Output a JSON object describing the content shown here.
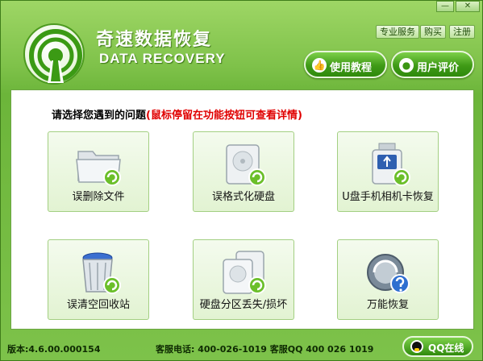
{
  "window": {
    "minimize_symbol": "—",
    "close_symbol": "✕"
  },
  "app": {
    "title": "奇速数据恢复",
    "subtitle": "DATA RECOVERY",
    "logo_icon": "signal-tower-icon"
  },
  "top_links": {
    "pro_service": "专业服务",
    "buy": "购买",
    "register": "注册"
  },
  "header_buttons": {
    "tutorial": {
      "label": "使用教程",
      "icon": "thumbs-up-icon"
    },
    "review": {
      "label": "用户评价",
      "icon": "user-icon"
    }
  },
  "main": {
    "prompt": "请选择您遇到的问题",
    "prompt_hint": "(鼠标停留在功能按钮可查看详情)",
    "tiles": [
      {
        "label": "误删除文件",
        "icon": "folder-recover-icon"
      },
      {
        "label": "误格式化硬盘",
        "icon": "harddisk-recover-icon"
      },
      {
        "label": "U盘手机相机卡恢复",
        "icon": "usb-drive-recover-icon"
      },
      {
        "label": "误清空回收站",
        "icon": "recycle-bin-recover-icon"
      },
      {
        "label": "硬盘分区丢失/损坏",
        "icon": "partition-recover-icon"
      },
      {
        "label": "万能恢复",
        "icon": "universal-help-icon"
      }
    ]
  },
  "footer": {
    "version": "版本:4.6.00.000154",
    "contact": "客服电话: 400-026-1019 客服QQ 400 026 1019",
    "qq_button": "QQ在线"
  },
  "colors": {
    "brand_green": "#3f9a16",
    "hint_red": "#e00000",
    "accent_recover": "#6bbf2a"
  }
}
